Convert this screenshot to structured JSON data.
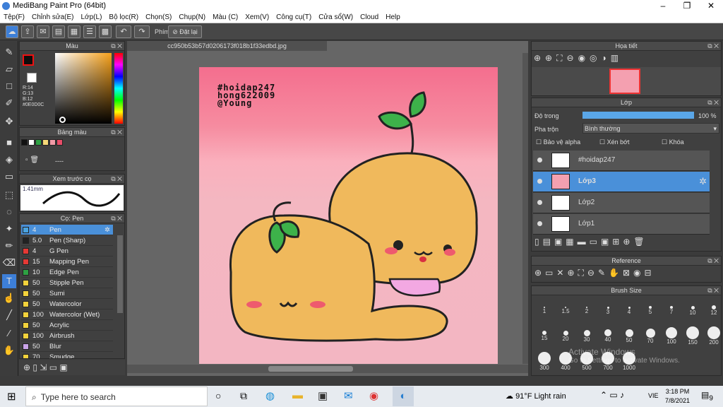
{
  "app": {
    "title": "MediBang Paint Pro (64bit)"
  },
  "menu": [
    "Tệp(F)",
    "Chỉnh sửa(E)",
    "Lớp(L)",
    "Bộ lọc(R)",
    "Chọn(S)",
    "Chụp(N)",
    "Màu (C)",
    "Xem(V)",
    "Công cụ(T)",
    "Cửa sổ(W)",
    "Cloud",
    "Help"
  ],
  "toolbar": {
    "phim_label": "Phím",
    "reset_label": "Đặt lại"
  },
  "color_panel": {
    "title": "Màu",
    "r": "R:14",
    "g": "G:13",
    "b": "B:12",
    "hex": "#0E0D0C"
  },
  "palette_panel": {
    "title": "Bảng màu",
    "swatches": [
      "#111111",
      "#ffffff",
      "#2ea043",
      "#f5d978",
      "#f19aa6",
      "#e84d68"
    ],
    "extra": "----"
  },
  "preview_panel": {
    "title": "Xem trước cọ",
    "size": "1.41mm"
  },
  "brush_panel": {
    "title": "Cọ: Pen",
    "items": [
      {
        "size": "4",
        "name": "Pen",
        "color": "#4aa3df",
        "selected": true
      },
      {
        "size": "5.0",
        "name": "Pen (Sharp)",
        "color": "#222222"
      },
      {
        "size": "4",
        "name": "G Pen",
        "color": "#e53935"
      },
      {
        "size": "15",
        "name": "Mapping Pen",
        "color": "#e53935"
      },
      {
        "size": "10",
        "name": "Edge Pen",
        "color": "#2ea043"
      },
      {
        "size": "50",
        "name": "Stipple Pen",
        "color": "#f2d23c"
      },
      {
        "size": "50",
        "name": "Sumi",
        "color": "#f2d23c"
      },
      {
        "size": "50",
        "name": "Watercolor",
        "color": "#f2d23c"
      },
      {
        "size": "100",
        "name": "Watercolor (Wet)",
        "color": "#f2d23c"
      },
      {
        "size": "50",
        "name": "Acrylic",
        "color": "#f2d23c"
      },
      {
        "size": "100",
        "name": "Airbrush",
        "color": "#f2d23c"
      },
      {
        "size": "50",
        "name": "Blur",
        "color": "#c9a3e8"
      },
      {
        "size": "70",
        "name": "Smudge",
        "color": "#f2d23c"
      }
    ]
  },
  "document": {
    "tab": "cc950b53b57d0206173f018b1f33edbd.jpg",
    "text_lines": [
      "#hoidap247",
      "hong622009",
      "@Young"
    ]
  },
  "navigator_panel": {
    "title": "Họa tiết"
  },
  "layer_panel": {
    "title": "Lớp",
    "opacity_label": "Độ trong",
    "opacity_value": "100 %",
    "opacity": 1.0,
    "blend_label": "Pha trộn",
    "blend_value": "Bình thường",
    "alpha_label": "Bảo vệ alpha",
    "clip_label": "Xén bớt",
    "lock_label": "Khóa",
    "layers": [
      {
        "name": "#hoidap247",
        "selected": false
      },
      {
        "name": "Lớp3",
        "selected": true
      },
      {
        "name": "Lớp2",
        "selected": false
      },
      {
        "name": "Lớp1",
        "selected": false
      }
    ]
  },
  "reference_panel": {
    "title": "Reference"
  },
  "brushsize_panel": {
    "title": "Brush Size",
    "sizes": [
      "1",
      "1.5",
      "2",
      "3",
      "4",
      "5",
      "7",
      "10",
      "12",
      "15",
      "20",
      "30",
      "40",
      "50",
      "70",
      "100",
      "150",
      "200",
      "300",
      "400",
      "500",
      "700",
      "1000"
    ]
  },
  "watermark": {
    "line1": "Activate Windows",
    "line2": "Go to Settings to activate Windows."
  },
  "taskbar": {
    "search_placeholder": "Type here to search",
    "weather": "91°F  Light rain",
    "lang": "VIE",
    "time": "3:18 PM",
    "date": "7/8/2021",
    "notif": "9"
  }
}
